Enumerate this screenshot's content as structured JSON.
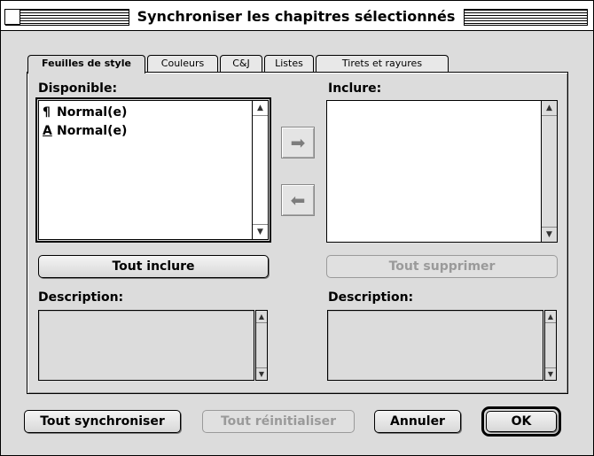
{
  "window": {
    "title": "Synchroniser les chapitres sélectionnés"
  },
  "tabs": [
    {
      "label": "Feuilles de style",
      "active": true
    },
    {
      "label": "Couleurs",
      "active": false
    },
    {
      "label": "C&J",
      "active": false
    },
    {
      "label": "Listes",
      "active": false
    },
    {
      "label": "Tirets et rayures",
      "active": false
    }
  ],
  "available": {
    "label": "Disponible:",
    "items": [
      {
        "icon": "¶",
        "icon_name": "paragraph-style-icon",
        "label": "Normal(e)"
      },
      {
        "icon": "A",
        "icon_name": "character-style-icon",
        "label": "Normal(e)"
      }
    ]
  },
  "include": {
    "label": "Inclure:",
    "items": []
  },
  "transfer": {
    "add_icon": "➡",
    "remove_icon": "⬅"
  },
  "buttons": {
    "include_all": "Tout inclure",
    "remove_all": "Tout supprimer",
    "sync_all": "Tout synchroniser",
    "reset_all": "Tout réinitialiser",
    "cancel": "Annuler",
    "ok": "OK"
  },
  "description": {
    "left_label": "Description:",
    "right_label": "Description:"
  },
  "icons": {
    "scroll_up": "▲",
    "scroll_down": "▼"
  }
}
